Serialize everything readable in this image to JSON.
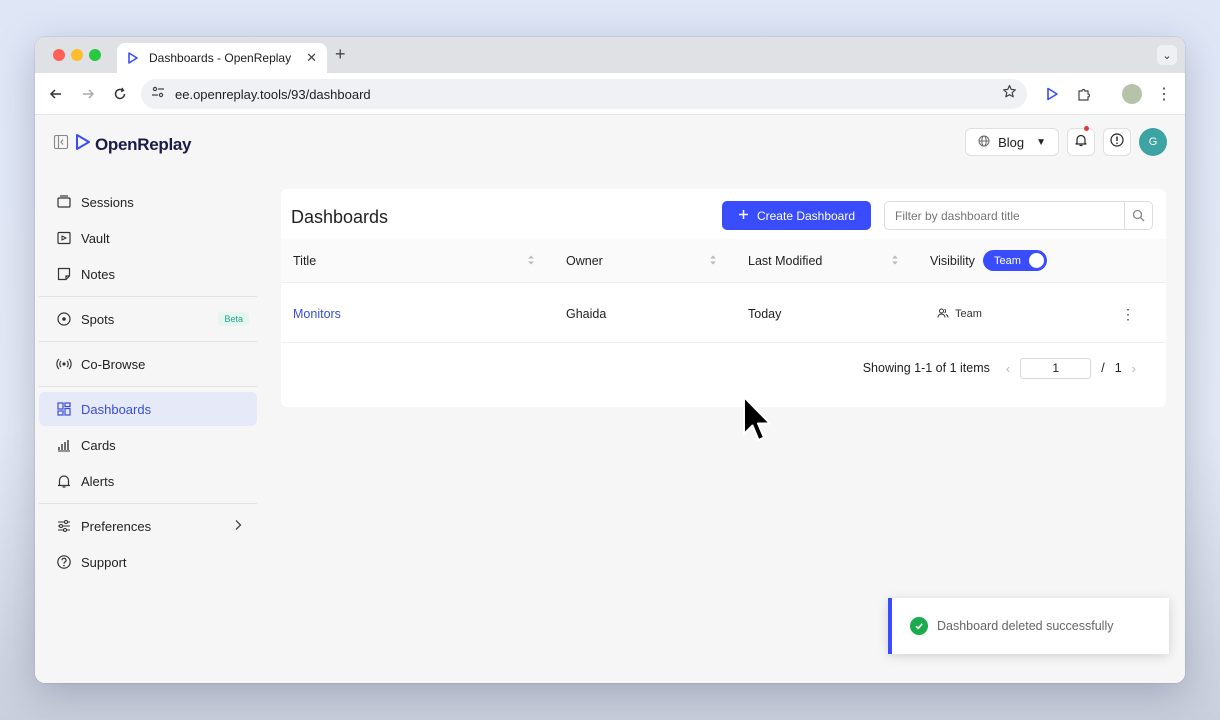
{
  "browser": {
    "tab_title": "Dashboards - OpenReplay",
    "url": "ee.openreplay.tools/93/dashboard"
  },
  "app": {
    "logo_text": "OpenReplay",
    "project_selector": "Blog",
    "user_initial": "G",
    "brand_color": "#394dfe"
  },
  "sidebar": {
    "items": [
      {
        "label": "Sessions",
        "icon": "sessions-icon"
      },
      {
        "label": "Vault",
        "icon": "vault-icon"
      },
      {
        "label": "Notes",
        "icon": "notes-icon"
      },
      {
        "label": "Spots",
        "icon": "spots-icon",
        "badge": "Beta"
      },
      {
        "label": "Co-Browse",
        "icon": "co-browse-icon"
      },
      {
        "label": "Dashboards",
        "icon": "dashboards-icon",
        "active": true
      },
      {
        "label": "Cards",
        "icon": "cards-icon"
      },
      {
        "label": "Alerts",
        "icon": "alerts-icon"
      },
      {
        "label": "Preferences",
        "icon": "preferences-icon"
      },
      {
        "label": "Support",
        "icon": "support-icon"
      }
    ]
  },
  "main": {
    "title": "Dashboards",
    "create_label": "Create Dashboard",
    "filter_placeholder": "Filter by dashboard title",
    "columns": {
      "title": "Title",
      "owner": "Owner",
      "last_modified": "Last Modified",
      "visibility": "Visibility",
      "visibility_toggle": "Team"
    },
    "rows": [
      {
        "title": "Monitors",
        "owner": "Ghaida",
        "last_modified": "Today",
        "visibility": "Team"
      }
    ],
    "pagination": {
      "summary": "Showing 1-1 of 1 items",
      "current_page": "1",
      "separator": "/",
      "total_pages": "1"
    }
  },
  "toast": {
    "message": "Dashboard deleted successfully",
    "status_color": "#1bab4c"
  }
}
